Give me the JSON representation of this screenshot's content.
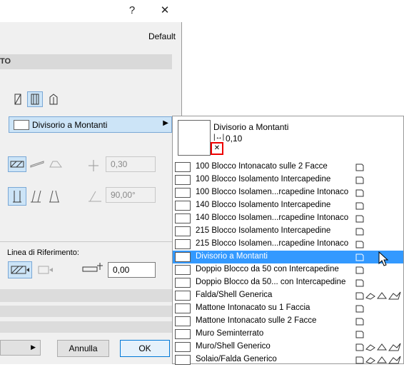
{
  "titlebar": {
    "help": "?",
    "close": "✕"
  },
  "header": {
    "default_label": "Default",
    "section_title": "TO"
  },
  "composite": {
    "label": "Divisorio a Montanti"
  },
  "geometry": {
    "thickness": "0,30",
    "angle": "90,00°"
  },
  "reference": {
    "label": "Linea di Riferimento:",
    "offset": "0,00"
  },
  "footer": {
    "cancel": "Annulla",
    "ok": "OK"
  },
  "popup": {
    "preview": {
      "name": "Divisorio a Montanti",
      "thickness": "0,10"
    },
    "items": [
      {
        "label": "100 Blocco Intonacato sulle 2 Facce",
        "pattern": "cross",
        "flags": [
          "wall"
        ]
      },
      {
        "label": "100 Blocco Isolamento Intercapedine",
        "pattern": "mixed",
        "flags": [
          "wall"
        ]
      },
      {
        "label": "100 Blocco Isolamen...rcapedine Intonaco",
        "pattern": "mixed",
        "flags": [
          "wall"
        ]
      },
      {
        "label": "140 Blocco Isolamento Intercapedine",
        "pattern": "mixed",
        "flags": [
          "wall"
        ]
      },
      {
        "label": "140 Blocco Isolamen...rcapedine Intonaco",
        "pattern": "mixed",
        "flags": [
          "wall"
        ]
      },
      {
        "label": "215 Blocco Isolamento Intercapedine",
        "pattern": "mixed",
        "flags": [
          "wall"
        ]
      },
      {
        "label": "215 Blocco Isolamen...rcapedine Intonaco",
        "pattern": "mixed",
        "flags": [
          "wall"
        ]
      },
      {
        "label": "Divisorio a Montanti",
        "pattern": "blank",
        "flags": [
          "wall"
        ],
        "selected": true
      },
      {
        "label": "Doppio Blocco da 50 con Intercapedine",
        "pattern": "mixed",
        "flags": [
          "wall"
        ]
      },
      {
        "label": "Doppio Blocco da 50... con Intercapedine",
        "pattern": "mixed",
        "flags": [
          "wall"
        ]
      },
      {
        "label": "Falda/Shell Generica",
        "pattern": "dot",
        "flags": [
          "wall",
          "slab",
          "roof",
          "shell"
        ]
      },
      {
        "label": "Mattone Intonacato su 1 Faccia",
        "pattern": "diag",
        "flags": [
          "wall"
        ]
      },
      {
        "label": "Mattone Intonacato sulle 2 Facce",
        "pattern": "diag",
        "flags": [
          "wall"
        ]
      },
      {
        "label": "Muro Seminterrato",
        "pattern": "dot",
        "flags": [
          "wall"
        ]
      },
      {
        "label": "Muro/Shell Generico",
        "pattern": "brick",
        "flags": [
          "wall",
          "slab",
          "roof",
          "shell"
        ]
      },
      {
        "label": "Solaio/Falda Generico",
        "pattern": "dot",
        "flags": [
          "wall",
          "slab",
          "roof",
          "shell"
        ]
      }
    ]
  },
  "colors": {
    "selection": "#3399ff",
    "panel": "#f0f0f0",
    "warning": "#e00000"
  }
}
